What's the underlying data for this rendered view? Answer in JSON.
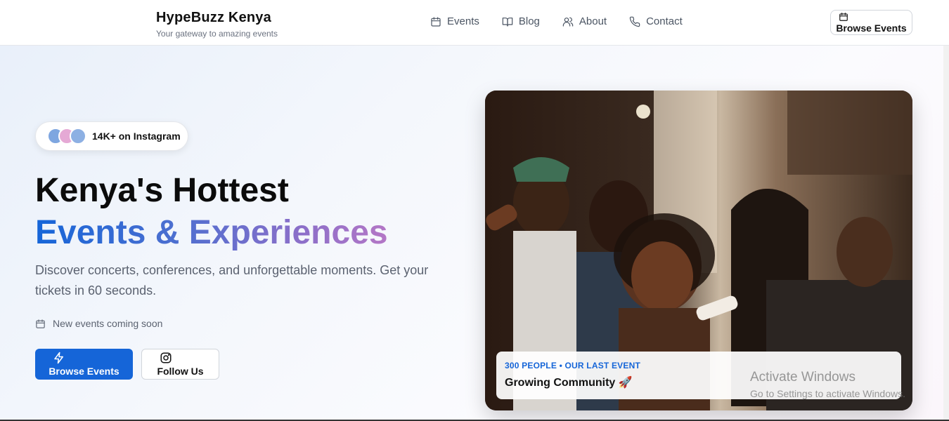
{
  "header": {
    "brand_title": "HypeBuzz Kenya",
    "brand_subtitle": "Your gateway to amazing events",
    "nav": [
      {
        "label": "Events",
        "icon": "calendar-icon"
      },
      {
        "label": "Blog",
        "icon": "book-icon"
      },
      {
        "label": "About",
        "icon": "users-icon"
      },
      {
        "label": "Contact",
        "icon": "phone-icon"
      }
    ],
    "cta_label": "Browse Events"
  },
  "hero": {
    "social_proof": "14K+ on Instagram",
    "headline_line1": "Kenya's Hottest",
    "headline_line2": "Events & Experiences",
    "description": "Discover concerts, conferences, and unforgettable moments. Get your tickets in 60 seconds.",
    "notice": "New events coming soon",
    "primary_button": "Browse Events",
    "secondary_button": "Follow Us"
  },
  "photo_card": {
    "caption_small": "300 PEOPLE • OUR LAST EVENT",
    "caption_big": "Growing Community 🚀"
  },
  "watermark": {
    "line1": "Activate Windows",
    "line2": "Go to Settings to activate Windows."
  },
  "colors": {
    "accent": "#1565d8",
    "gradient_end": "#b477c6"
  }
}
